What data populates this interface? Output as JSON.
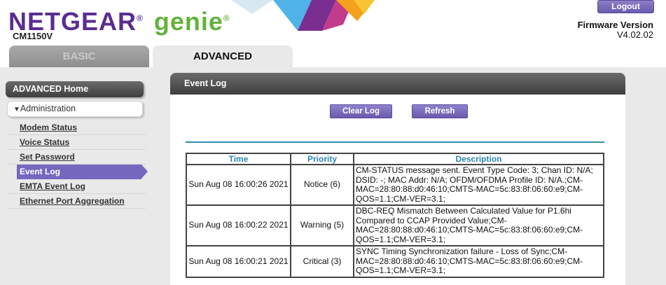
{
  "header": {
    "brand": "NETGEAR",
    "product": "genie",
    "model": "CM1150V",
    "logout_label": "Logout",
    "firmware_label": "Firmware Version",
    "firmware_version": "V4.02.02"
  },
  "tabs": {
    "basic": "BASIC",
    "advanced": "ADVANCED"
  },
  "sidebar": {
    "home": "ADVANCED Home",
    "section": "Administration",
    "items": [
      {
        "label": "Modem Status"
      },
      {
        "label": "Voice Status"
      },
      {
        "label": "Set Password"
      },
      {
        "label": "Event Log"
      },
      {
        "label": "EMTA Event Log"
      },
      {
        "label": "Ethernet Port Aggregation"
      }
    ]
  },
  "panel": {
    "title": "Event Log",
    "clear_label": "Clear Log",
    "refresh_label": "Refresh"
  },
  "table": {
    "headers": {
      "time": "Time",
      "priority": "Priority",
      "description": "Description"
    },
    "rows": [
      {
        "time": "Sun Aug 08 16:00:26 2021",
        "priority": "Notice (6)",
        "description": "CM-STATUS message sent. Event Type Code: 3; Chan ID: N/A; DSID: -; MAC Addr: N/A; OFDM/OFDMA Profile ID: N/A.;CM-MAC=28:80:88:d0:46:10;CMTS-MAC=5c:83:8f:06:60:e9;CM-QOS=1.1;CM-VER=3.1;"
      },
      {
        "time": "Sun Aug 08 16:00:22 2021",
        "priority": "Warning (5)",
        "description": "DBC-REQ Mismatch Between Calculated Value for P1.6hi Compared to CCAP Provided Value;CM-MAC=28:80:88:d0:46:10;CMTS-MAC=5c:83:8f:06:60:e9;CM-QOS=1.1;CM-VER=3.1;"
      },
      {
        "time": "Sun Aug 08 16:00:21 2021",
        "priority": "Critical (3)",
        "description": "SYNC Timing Synchronization failure - Loss of Sync;CM-MAC=28:80:88:d0:46:10;CMTS-MAC=5c:83:8f:06:60:e9;CM-QOS=1.1;CM-VER=3.1;"
      }
    ]
  },
  "colors": {
    "brand_purple": "#5a2d91",
    "brand_green": "#63b23c",
    "button_purple": "#7567bd",
    "header_teal": "#2d86b8"
  }
}
